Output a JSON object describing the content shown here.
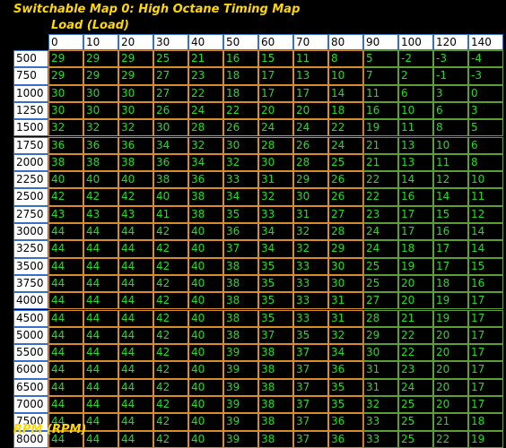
{
  "title": "Switchable Map 0: High Octane Timing Map",
  "x_axis_label": "Load (Load)",
  "y_axis_label": "RPM (RPM)",
  "colors": {
    "label": "#ffd800",
    "value_text": "#22dd22",
    "header_bg": "#ffffff",
    "cell_border": "#d98c2a"
  },
  "load_columns": [
    "0",
    "10",
    "20",
    "30",
    "40",
    "50",
    "60",
    "70",
    "80",
    "90",
    "100",
    "120",
    "140"
  ],
  "rpm_rows": [
    "500",
    "750",
    "1000",
    "1250",
    "1500",
    "1750",
    "2000",
    "2250",
    "2500",
    "2750",
    "3000",
    "3250",
    "3500",
    "3750",
    "4000",
    "4500",
    "5000",
    "5500",
    "6000",
    "6500",
    "7000",
    "7500",
    "8000"
  ],
  "values": [
    [
      "29",
      "29",
      "29",
      "25",
      "21",
      "16",
      "15",
      "11",
      "8",
      "5",
      "-2",
      "-3",
      "-4"
    ],
    [
      "29",
      "29",
      "29",
      "27",
      "23",
      "18",
      "17",
      "13",
      "10",
      "7",
      "2",
      "-1",
      "-3"
    ],
    [
      "30",
      "30",
      "30",
      "27",
      "22",
      "18",
      "17",
      "17",
      "14",
      "11",
      "6",
      "3",
      "0"
    ],
    [
      "30",
      "30",
      "30",
      "26",
      "24",
      "22",
      "20",
      "20",
      "18",
      "16",
      "10",
      "6",
      "3"
    ],
    [
      "32",
      "32",
      "32",
      "30",
      "28",
      "26",
      "24",
      "24",
      "22",
      "19",
      "11",
      "8",
      "5"
    ],
    [
      "36",
      "36",
      "36",
      "34",
      "32",
      "30",
      "28",
      "26",
      "24",
      "21",
      "13",
      "10",
      "6"
    ],
    [
      "38",
      "38",
      "38",
      "36",
      "34",
      "32",
      "30",
      "28",
      "25",
      "21",
      "13",
      "11",
      "8"
    ],
    [
      "40",
      "40",
      "40",
      "38",
      "36",
      "33",
      "31",
      "29",
      "26",
      "22",
      "14",
      "12",
      "10"
    ],
    [
      "42",
      "42",
      "42",
      "40",
      "38",
      "34",
      "32",
      "30",
      "26",
      "22",
      "16",
      "14",
      "11"
    ],
    [
      "43",
      "43",
      "43",
      "41",
      "38",
      "35",
      "33",
      "31",
      "27",
      "23",
      "17",
      "15",
      "12"
    ],
    [
      "44",
      "44",
      "44",
      "42",
      "40",
      "36",
      "34",
      "32",
      "28",
      "24",
      "17",
      "16",
      "14"
    ],
    [
      "44",
      "44",
      "44",
      "42",
      "40",
      "37",
      "34",
      "32",
      "29",
      "24",
      "18",
      "17",
      "14"
    ],
    [
      "44",
      "44",
      "44",
      "42",
      "40",
      "38",
      "35",
      "33",
      "30",
      "25",
      "19",
      "17",
      "15"
    ],
    [
      "44",
      "44",
      "44",
      "42",
      "40",
      "38",
      "35",
      "33",
      "30",
      "25",
      "20",
      "18",
      "16"
    ],
    [
      "44",
      "44",
      "44",
      "42",
      "40",
      "38",
      "35",
      "33",
      "31",
      "27",
      "20",
      "19",
      "17"
    ],
    [
      "44",
      "44",
      "44",
      "42",
      "40",
      "38",
      "35",
      "33",
      "31",
      "28",
      "21",
      "19",
      "17"
    ],
    [
      "44",
      "44",
      "44",
      "42",
      "40",
      "38",
      "37",
      "35",
      "32",
      "29",
      "22",
      "20",
      "17"
    ],
    [
      "44",
      "44",
      "44",
      "42",
      "40",
      "39",
      "38",
      "37",
      "34",
      "30",
      "22",
      "20",
      "17"
    ],
    [
      "44",
      "44",
      "44",
      "42",
      "40",
      "39",
      "38",
      "37",
      "36",
      "31",
      "23",
      "20",
      "17"
    ],
    [
      "44",
      "44",
      "44",
      "42",
      "40",
      "39",
      "38",
      "37",
      "35",
      "31",
      "24",
      "20",
      "17"
    ],
    [
      "44",
      "44",
      "44",
      "42",
      "40",
      "39",
      "38",
      "37",
      "35",
      "32",
      "25",
      "20",
      "17"
    ],
    [
      "44",
      "44",
      "44",
      "42",
      "40",
      "39",
      "38",
      "37",
      "36",
      "33",
      "25",
      "21",
      "18"
    ],
    [
      "44",
      "44",
      "44",
      "42",
      "40",
      "39",
      "38",
      "37",
      "36",
      "33",
      "25",
      "22",
      "19"
    ]
  ]
}
